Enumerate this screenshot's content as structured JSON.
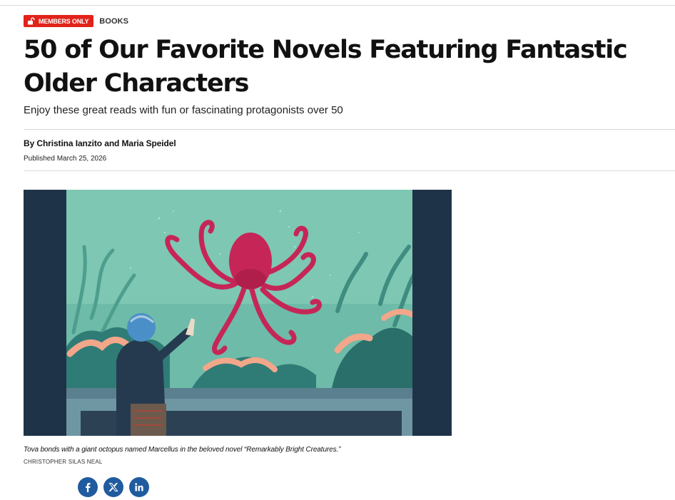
{
  "badges": {
    "members_only": "MEMBERS ONLY",
    "section": "BOOKS"
  },
  "article": {
    "headline": "50 of Our Favorite Novels Featuring Fantastic Older Characters",
    "dek": "Enjoy these great reads with fun or fascinating protagonists over 50",
    "byline": "By Christina Ianzito and Maria Speidel",
    "published": "Published March 25, 2026"
  },
  "image": {
    "caption": "Tova bonds with a giant octopus named Marcellus in the beloved novel “Remarkably Bright Creatures.”",
    "credit": "CHRISTOPHER SILAS NEAL"
  },
  "share": [
    {
      "network": "facebook",
      "icon": "facebook-icon"
    },
    {
      "network": "x",
      "icon": "x-icon"
    },
    {
      "network": "linkedin",
      "icon": "linkedin-icon"
    }
  ],
  "colors": {
    "accent_red": "#e2231a",
    "share_blue": "#1f5b9e",
    "aquarium_water": "#7ec7b3",
    "octopus": "#c62657",
    "frame_navy": "#1f3348"
  }
}
